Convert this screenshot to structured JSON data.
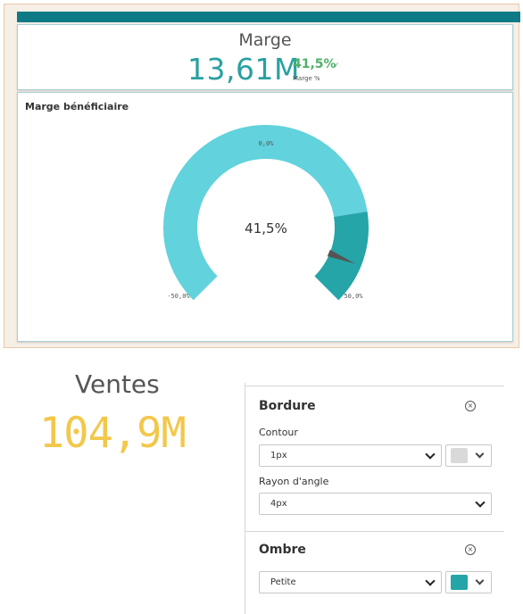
{
  "kpi": {
    "title": "Marge",
    "value": "13,61M",
    "secondary_value": "41,5%",
    "secondary_indicator_icon": "check-icon",
    "secondary_label": "Marge %"
  },
  "gauge": {
    "title": "Marge bénéficiaire",
    "value_label": "41,5%",
    "min_label": "-50,0%",
    "mid_label": "0,0%",
    "max_label": "50,0%",
    "colors": {
      "main": "#62d2dc",
      "high_segment": "#25a5a8",
      "needle": "#555555"
    }
  },
  "chart_data": {
    "type": "gauge",
    "title": "Marge bénéficiaire",
    "value": 41.5,
    "range": [
      -50,
      50
    ],
    "ticks": [
      "-50,0%",
      "0,0%",
      "50,0%"
    ],
    "segments": [
      {
        "from": -50,
        "to": 30,
        "color": "#62d2dc"
      },
      {
        "from": 30,
        "to": 50,
        "color": "#25a5a8"
      }
    ]
  },
  "ventes": {
    "title": "Ventes",
    "value": "104,9M",
    "value_color": "#f2c84b"
  },
  "properties": {
    "border_section": {
      "title": "Bordure",
      "contour_label": "Contour",
      "contour_value": "1px",
      "contour_color": "#d9d9d9",
      "radius_label": "Rayon d'angle",
      "radius_value": "4px"
    },
    "shadow_section": {
      "title": "Ombre",
      "shadow_value": "Petite",
      "shadow_color": "#25a5a8"
    }
  }
}
